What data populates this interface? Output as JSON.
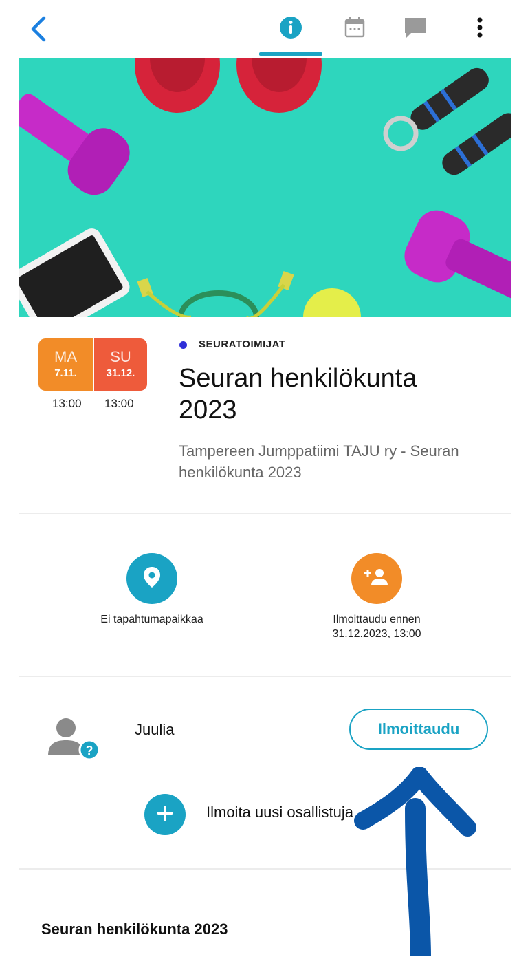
{
  "topbar": {
    "back": "back-icon",
    "tabs": [
      {
        "icon": "info-icon",
        "active": true
      },
      {
        "icon": "calendar-icon",
        "active": false
      },
      {
        "icon": "chat-icon",
        "active": false
      },
      {
        "icon": "more-vertical-icon",
        "active": false
      }
    ]
  },
  "event": {
    "start_day": "MA",
    "start_date": "7.11.",
    "end_day": "SU",
    "end_date": "31.12.",
    "start_time": "13:00",
    "end_time": "13:00",
    "category": "SEURATOIMIJAT",
    "category_color": "#2f2fd8",
    "title_line1": "Seuran henkilökunta",
    "title_line2": "2023",
    "subtitle_line1": "Tampereen Jumppatiimi TAJU ry - Seuran",
    "subtitle_line2": "henkilökunta 2023"
  },
  "actions": {
    "location_label": "Ei tapahtumapaikkaa",
    "registration_line1": "Ilmoittaudu ennen",
    "registration_line2": "31.12.2023, 13:00"
  },
  "participant": {
    "name": "Juulia",
    "register_button": "Ilmoittaudu",
    "add_new": "Ilmoita uusi osallistuja"
  },
  "section": {
    "title": "Seuran henkilökunta 2023"
  },
  "colors": {
    "accent": "#1aa3c4",
    "orange": "#f28c28",
    "red_orange": "#ee5b3b",
    "arrow": "#0b56a8"
  }
}
